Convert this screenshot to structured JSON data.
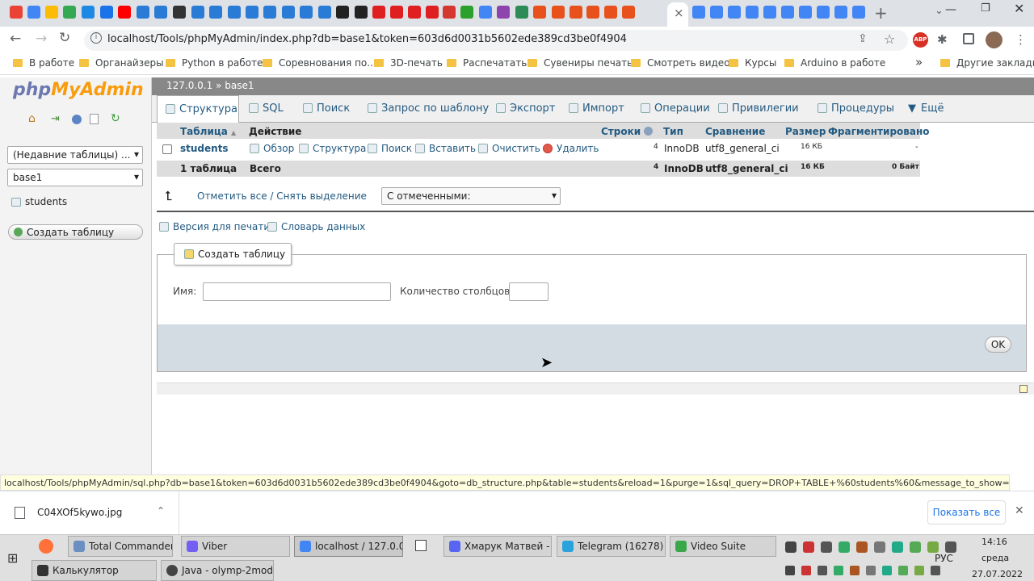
{
  "browser": {
    "active_tab_close": "×",
    "new_tab": "+",
    "url": "localhost/Tools/phpMyAdmin/index.php?db=base1&token=603d6d0031b5602ede389cd3be0f4904",
    "bookmarks": [
      "В работе",
      "Органайзеры",
      "Python в работе",
      "Соревнования по...",
      "3D-печать",
      "Распечатать",
      "Сувениры печать",
      "Смотреть видео",
      "Курсы",
      "Arduino в работе"
    ],
    "other_bookmarks": "Другие закладки",
    "bookmarks_more": "»",
    "extension_abp": "ABP"
  },
  "sidebar": {
    "logo_php": "php",
    "logo_myadmin": "MyAdmin",
    "recent_tables": "(Недавние таблицы) ...",
    "db_select": "base1",
    "table_item": "students",
    "create_table": "Создать таблицу"
  },
  "breadcrumb": {
    "server": "127.0.0.1",
    "sep": "»",
    "db": "base1"
  },
  "tabs": [
    "Структура",
    "SQL",
    "Поиск",
    "Запрос по шаблону",
    "Экспорт",
    "Импорт",
    "Операции",
    "Привилегии",
    "Процедуры",
    "Ещё"
  ],
  "table": {
    "headers": [
      "Таблица",
      "Действие",
      "Строки",
      "Тип",
      "Сравнение",
      "Размер",
      "Фрагментировано"
    ],
    "sort_arrow": "▲",
    "row": {
      "name": "students",
      "actions": [
        "Обзор",
        "Структура",
        "Поиск",
        "Вставить",
        "Очистить",
        "Удалить"
      ],
      "rows": "4",
      "type": "InnoDB",
      "collation": "utf8_general_ci",
      "size": "16 КБ",
      "overhead": "-"
    },
    "total": {
      "label": "1 таблица",
      "sum": "Всего",
      "rows": "4",
      "type": "InnoDB",
      "collation": "utf8_general_ci",
      "size": "16 КБ",
      "overhead": "0 Байт"
    }
  },
  "bulk": {
    "check_all": "Отметить все / Снять выделение",
    "with_selected": "С отмеченными:"
  },
  "links": {
    "print": "Версия для печати",
    "dictionary": "Словарь данных"
  },
  "create_form": {
    "legend": "Создать таблицу",
    "name_label": "Имя:",
    "cols_label": "Количество столбцов:",
    "ok": "OK"
  },
  "status_url": "localhost/Tools/phpMyAdmin/sql.php?db=base1&token=603d6d0031b5602ede389cd3be0f4904&goto=db_structure.php&table=students&reload=1&purge=1&sql_query=DROP+TABLE+%60students%60&message_to_show=Таблица+students+б...",
  "downloads": {
    "file": "C04XOf5kywo.jpg",
    "show_all": "Показать все"
  },
  "taskbar": {
    "row1": [
      "Total Commander...",
      "Viber",
      "localhost / 127.0.0....",
      "Хмарук Матвей - ...",
      "Telegram (16278)",
      "Video Suite"
    ],
    "row2": [
      "Калькулятор",
      "Java - olymp-2modu..."
    ],
    "lang": "РУС",
    "time": "14:16",
    "day": "среда",
    "date": "27.07.2022"
  }
}
